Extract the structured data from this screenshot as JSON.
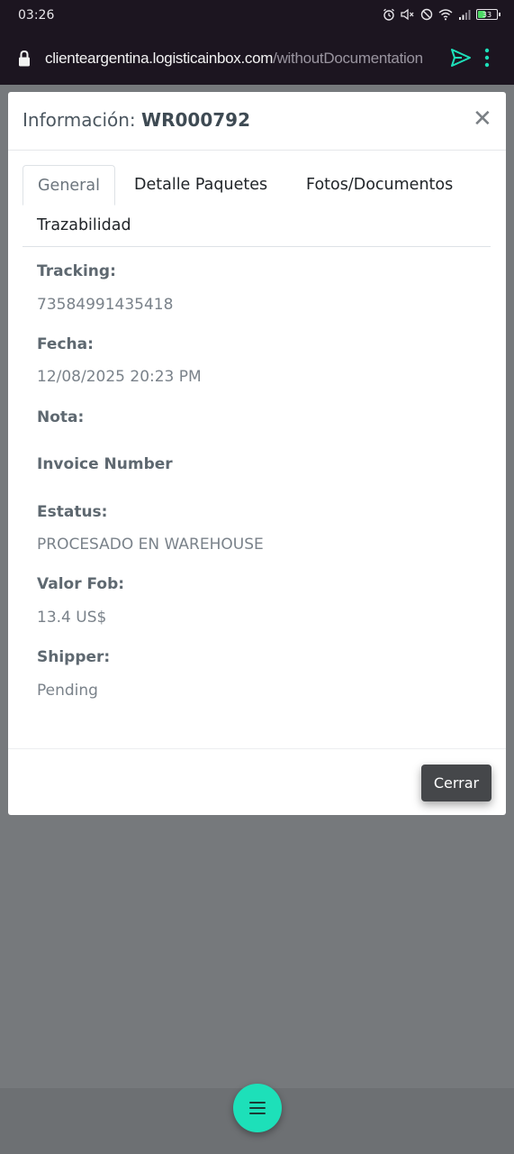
{
  "status_bar": {
    "time": "03:26",
    "battery": "33",
    "network": "4G"
  },
  "browser": {
    "url_host": "clienteargentina.logisticainbox.com",
    "url_path": "/withoutDocumentation",
    "accent_color": "#1de0b9"
  },
  "modal": {
    "title_prefix": "Información: ",
    "title_id": "WR000792",
    "close_symbol": "✕",
    "tabs": [
      {
        "label": "General",
        "active": true
      },
      {
        "label": "Detalle Paquetes",
        "active": false
      },
      {
        "label": "Fotos/Documentos",
        "active": false
      },
      {
        "label": "Trazabilidad",
        "active": false
      }
    ],
    "fields": {
      "tracking": {
        "label": "Tracking:",
        "value": "73584991435418"
      },
      "fecha": {
        "label": "Fecha:",
        "value": "12/08/2025 20:23 PM"
      },
      "nota": {
        "label": "Nota:",
        "value": ""
      },
      "invoice": {
        "label": "Invoice Number",
        "value": ""
      },
      "estatus": {
        "label": "Estatus:",
        "value": "PROCESADO EN WAREHOUSE"
      },
      "valor_fob": {
        "label": "Valor Fob:",
        "value": "13.4 US$"
      },
      "shipper": {
        "label": "Shipper:",
        "value": "Pending"
      }
    },
    "close_button": "Cerrar"
  },
  "fab": {
    "icon": "menu-icon"
  }
}
